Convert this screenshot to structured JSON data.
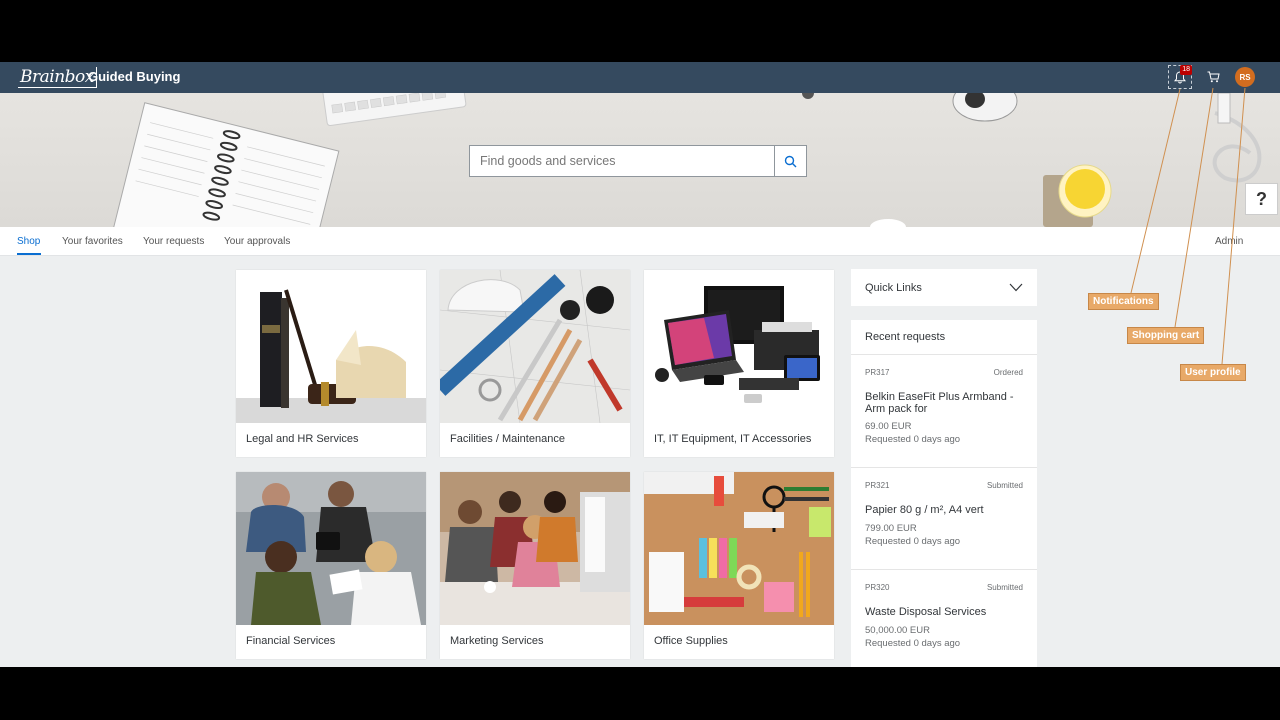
{
  "header": {
    "logo": "Brainbox",
    "title": "Guided Buying",
    "notification_count": "18",
    "avatar_initials": "RS"
  },
  "search": {
    "placeholder": "Find goods and services"
  },
  "tabs": [
    {
      "label": "Shop",
      "active": true
    },
    {
      "label": "Your favorites"
    },
    {
      "label": "Your requests"
    },
    {
      "label": "Your approvals"
    }
  ],
  "admin_label": "Admin",
  "help_label": "?",
  "categories": [
    {
      "label": "Legal and HR Services"
    },
    {
      "label": "Facilities / Maintenance"
    },
    {
      "label": "IT, IT Equipment, IT Accessories"
    },
    {
      "label": "Financial Services"
    },
    {
      "label": "Marketing Services"
    },
    {
      "label": "Office Supplies"
    }
  ],
  "quick_links": {
    "label": "Quick Links"
  },
  "recent_requests": {
    "title": "Recent requests",
    "items": [
      {
        "id": "PR317",
        "status": "Ordered",
        "name": "Belkin EaseFit Plus Armband - Arm pack for",
        "price": "69.00 EUR",
        "date": "Requested 0 days ago"
      },
      {
        "id": "PR321",
        "status": "Submitted",
        "name": "Papier 80 g / m², A4 vert",
        "price": "799.00 EUR",
        "date": "Requested 0 days ago"
      },
      {
        "id": "PR320",
        "status": "Submitted",
        "name": "Waste Disposal Services",
        "price": "50,000.00 EUR",
        "date": "Requested 0 days ago"
      }
    ]
  },
  "annotations": {
    "notifications": "Notifications",
    "cart": "Shopping cart",
    "profile": "User profile"
  },
  "colors": {
    "shellbar": "#354a5f",
    "accent": "#0a6ed1",
    "callout": "#e8a968",
    "avatar": "#d36d1f"
  }
}
